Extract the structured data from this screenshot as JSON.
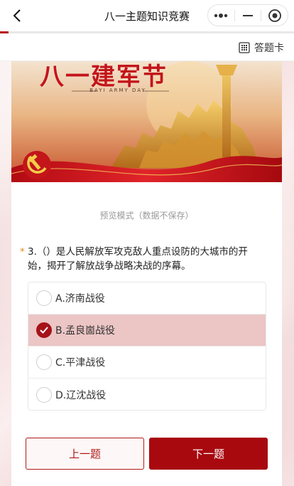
{
  "window": {
    "title": "八一主题知识竞赛"
  },
  "progress": {
    "fraction": 0.03
  },
  "toolbar": {
    "answer_card_label": "答题卡",
    "answer_card_icon": "grid-icon"
  },
  "banner": {
    "title": "八一建军节",
    "subtitle": "BAYI ARMY DAY"
  },
  "preview_notice": "预览模式（数据不保存）",
  "question": {
    "required_mark": "*",
    "text": "3.（）是人民解放军攻克敌人重点设防的大城市的开始，揭开了解放战争战略决战的序幕。"
  },
  "options": [
    {
      "label": "A.济南战役",
      "selected": false
    },
    {
      "label": "B.孟良崮战役",
      "selected": true
    },
    {
      "label": "C.平津战役",
      "selected": false
    },
    {
      "label": "D.辽沈战役",
      "selected": false
    }
  ],
  "buttons": {
    "prev": "上一题",
    "next": "下一题"
  },
  "colors": {
    "accent": "#a8090f",
    "selected_bg": "#ecc5c5",
    "required": "#e28a1b"
  }
}
